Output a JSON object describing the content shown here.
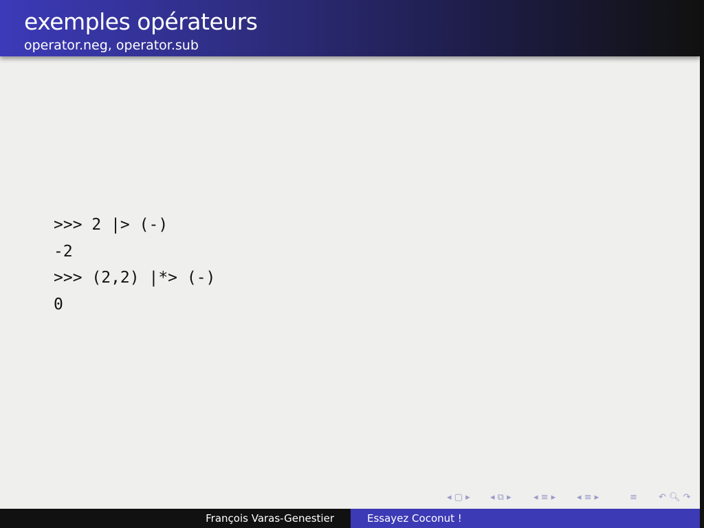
{
  "header": {
    "title": "exemples opérateurs",
    "subtitle": "operator.neg, operator.sub"
  },
  "code": {
    "lines": [
      ">>> 2 |> (-)",
      "-2",
      ">>> (2,2) |*> (-)",
      "0"
    ]
  },
  "nav": {
    "icons": [
      "nav-frame-icon",
      "nav-subsection-icon",
      "nav-section-icon",
      "nav-document-icon",
      "nav-toc-icon",
      "nav-back-search-forward-icon"
    ],
    "glyphs": {
      "frame": "◂ ▢ ▸",
      "subsection": "◂ ⧉ ▸",
      "section": "◂ ≡ ▸",
      "document": "◂ ≡ ▸",
      "toc": "≡",
      "search": "↶ 🔍︎ ↷"
    }
  },
  "footer": {
    "author": "François Varas-Genestier",
    "title": "Essayez Coconut !"
  }
}
